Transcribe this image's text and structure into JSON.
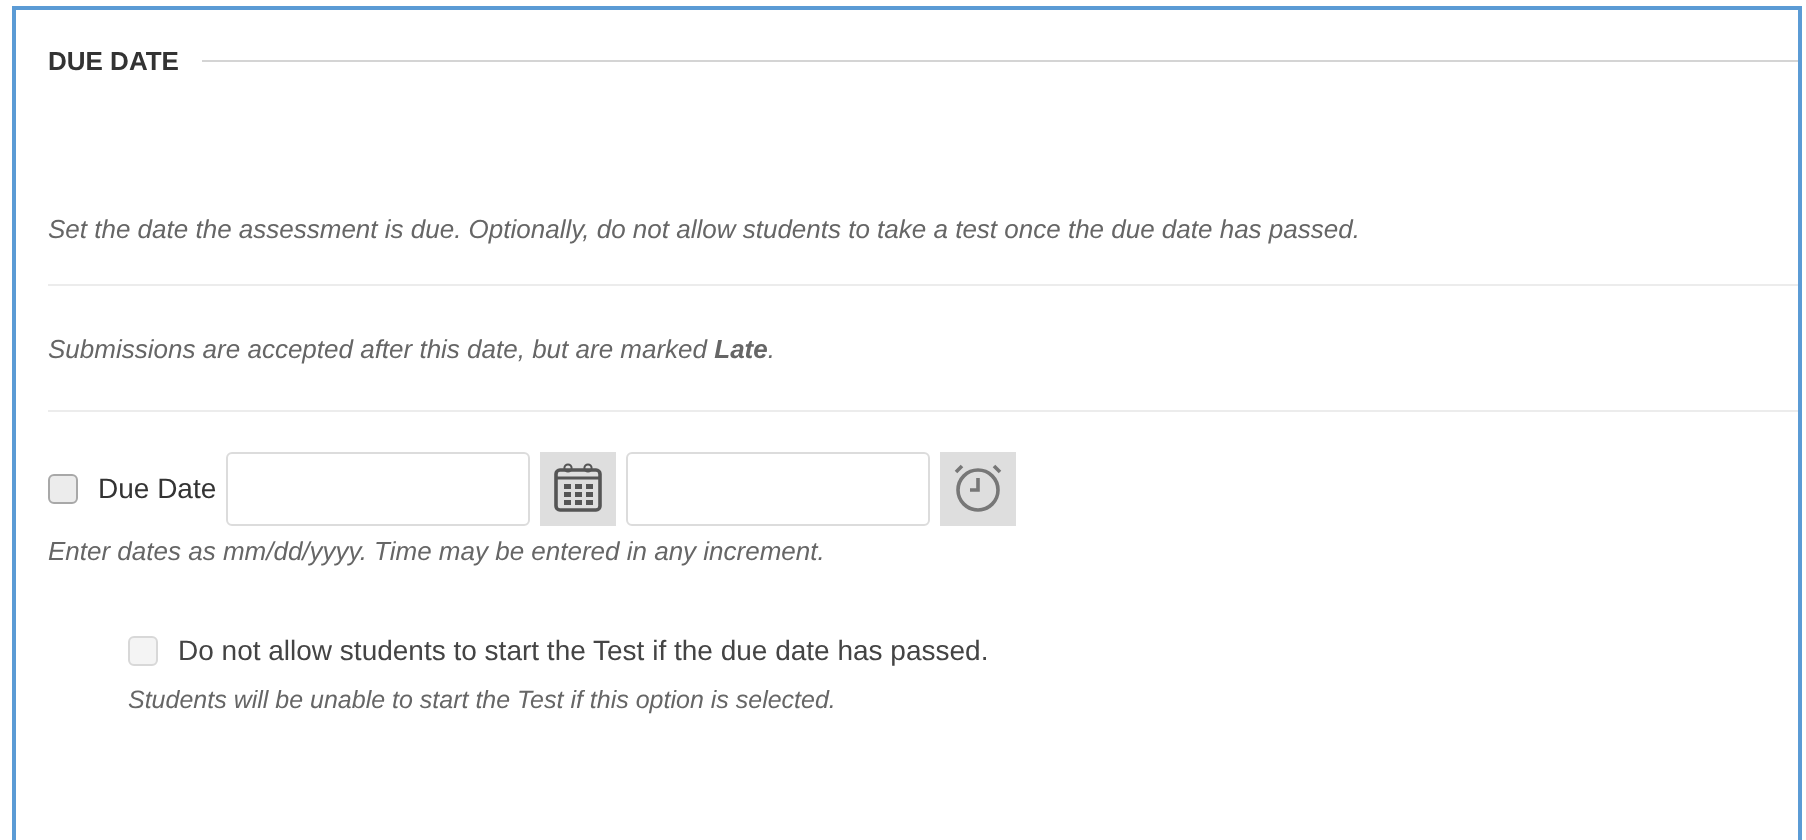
{
  "section": {
    "title": "DUE DATE"
  },
  "description": "Set the date the assessment is due. Optionally, do not allow students to take a test once the due date has passed.",
  "late_note": "Submissions are accepted after this date, but are marked **Late**.",
  "due_date": {
    "label": "Due Date",
    "checked": false,
    "hint": "Enter dates as mm/dd/yyyy. Time may be entered in any increment."
  },
  "option": {
    "label": "Do not allow students to start the Test if the due date has passed.",
    "checked": false,
    "disabled": true,
    "hint": "Students will be unable to start the Test if this option is selected."
  }
}
